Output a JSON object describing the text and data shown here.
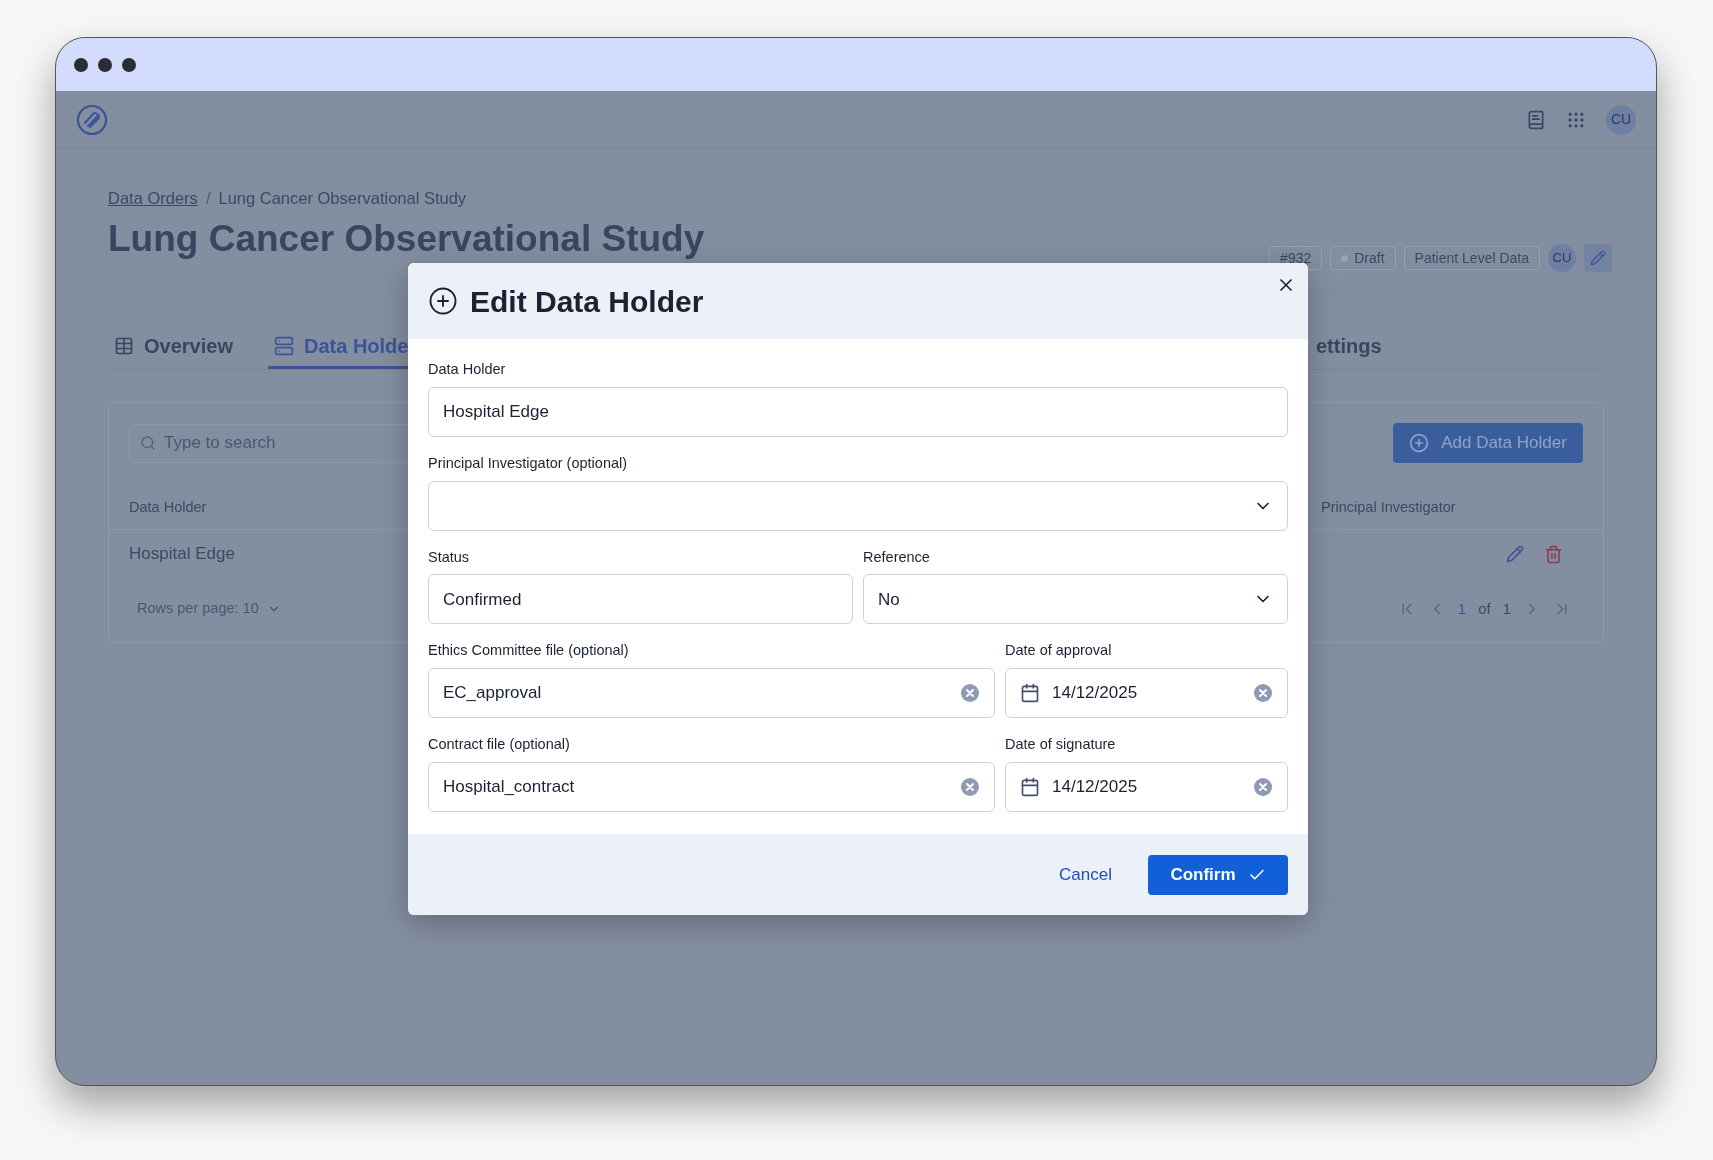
{
  "app_header": {
    "avatar": "CU"
  },
  "breadcrumb": {
    "separator": "/",
    "items": [
      {
        "label": "Data Orders",
        "link": true
      },
      {
        "label": "Lung Cancer Observational Study",
        "link": false
      }
    ]
  },
  "page": {
    "title": "Lung Cancer Observational Study",
    "badges": [
      {
        "kind": "id",
        "label": "#932"
      },
      {
        "kind": "status",
        "label": "Draft"
      },
      {
        "kind": "type",
        "label": "Patient Level Data"
      }
    ],
    "owner_avatar": "CU"
  },
  "tabs": [
    {
      "label": "Overview",
      "selected": false
    },
    {
      "label": "Data Holde",
      "selected": true
    },
    {
      "label": "ettings",
      "selected": false
    }
  ],
  "table": {
    "search": {
      "placeholder": "Type to search"
    },
    "add_button": "Add Data Holder",
    "columns": [
      "Data Holder",
      "Principal Investigator"
    ],
    "rows": [
      {
        "data_holder": "Hospital Edge"
      }
    ],
    "pagination": {
      "rows_per_page": "Rows per page: 10",
      "current": "1",
      "of": "of",
      "total": "1"
    }
  },
  "dialog": {
    "title": "Edit Data Holder",
    "rows": [
      {
        "fields": [
          {
            "label": "Data Holder",
            "kind": "text",
            "value": "Hospital Edge"
          }
        ]
      },
      {
        "fields": [
          {
            "label": "Principal Investigator (optional)",
            "kind": "select"
          }
        ]
      },
      {
        "fields": [
          {
            "label": "Status",
            "kind": "text",
            "value": "Confirmed"
          },
          {
            "label": "Reference",
            "kind": "select",
            "value": "No"
          }
        ]
      },
      {
        "fields": [
          {
            "label": "Ethics Committee file (optional)",
            "kind": "file",
            "value": "EC_approval"
          },
          {
            "label": "Date of approval",
            "kind": "date",
            "value": "14/12/2025"
          }
        ]
      },
      {
        "fields": [
          {
            "label": "Contract file (optional)",
            "kind": "file",
            "value": "Hospital_contract"
          },
          {
            "label": "Date of signature",
            "kind": "date",
            "value": "14/12/2025"
          }
        ]
      }
    ],
    "cancel": "Cancel",
    "confirm": "Confirm"
  }
}
